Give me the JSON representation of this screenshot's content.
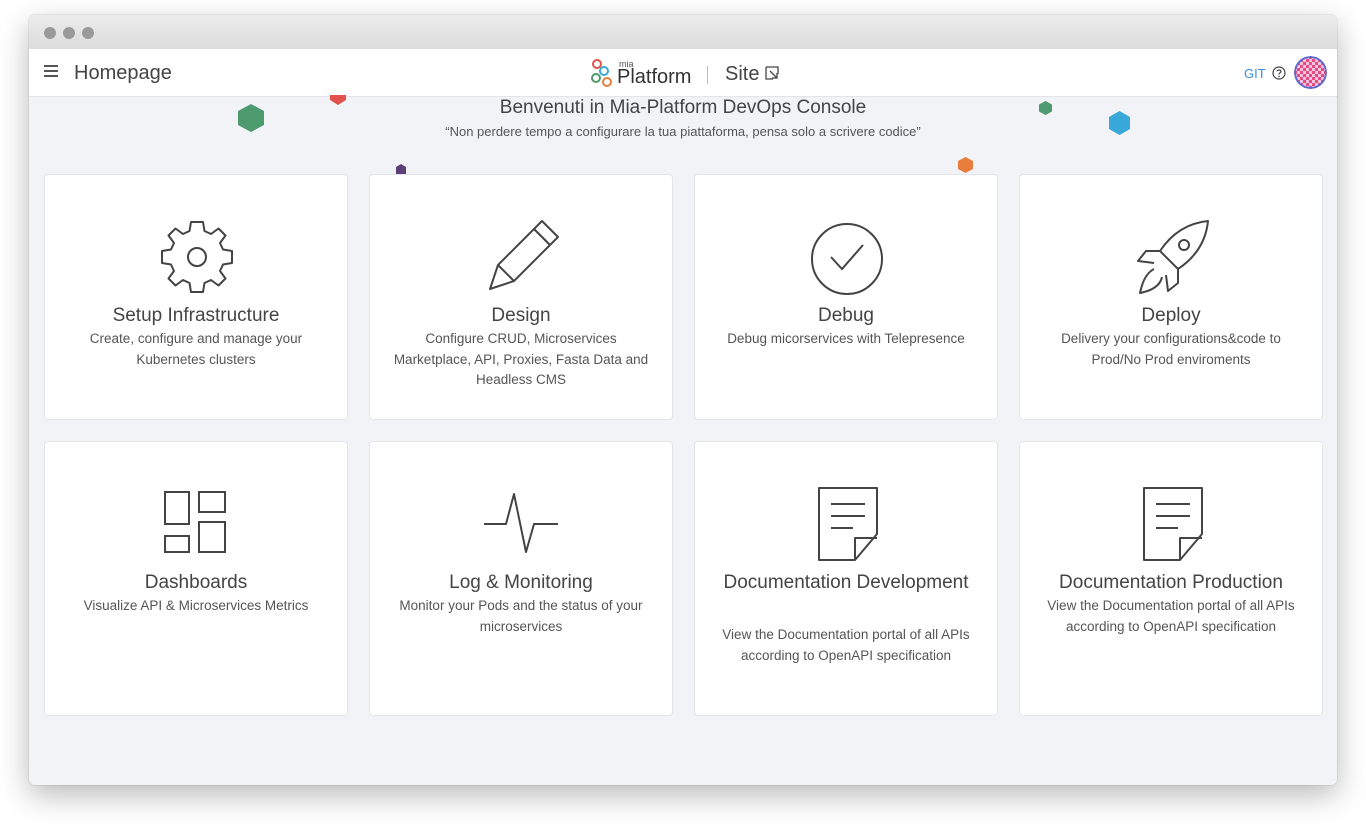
{
  "header": {
    "page_title": "Homepage",
    "brand_small": "mia",
    "brand_name": "Platform",
    "site_label": "Site",
    "git_label": "GIT"
  },
  "welcome": {
    "title": "Benvenuti in Mia-Platform DevOps Console",
    "tagline": "“Non perdere tempo a configurare la tua piattaforma, pensa solo a scrivere codice”"
  },
  "colors": {
    "accent": "#3a8ee6",
    "text": "#444444",
    "background": "#f2f3f6",
    "card": "#ffffff",
    "hex_green": "#4e9a6f",
    "hex_red": "#e0524b",
    "hex_purple": "#5a3f7a",
    "hex_blue": "#3aa7d9",
    "hex_orange": "#e87e3c"
  },
  "cards": [
    {
      "title": "Setup Infrastructure",
      "description": "Create, configure and manage your Kubernetes clusters",
      "icon": "gear-icon"
    },
    {
      "title": "Design",
      "description": "Configure CRUD, Microservices Marketplace, API, Proxies, Fasta Data and Headless CMS",
      "icon": "pencil-icon"
    },
    {
      "title": "Debug",
      "description": "Debug micorservices with Telepresence",
      "icon": "check-circle-icon"
    },
    {
      "title": "Deploy",
      "description": "Delivery your configurations&code to Prod/No Prod enviroments",
      "icon": "rocket-icon"
    },
    {
      "title": "Dashboards",
      "description": "Visualize API & Microservices Metrics",
      "icon": "dashboard-grid-icon"
    },
    {
      "title": "Log & Monitoring",
      "description": "Monitor your Pods and the status of your microservices",
      "icon": "pulse-icon"
    },
    {
      "title": "Documentation Development",
      "description": "View the Documentation portal of all APIs according to OpenAPI specification",
      "icon": "document-icon"
    },
    {
      "title": "Documentation Production",
      "description": "View the Documentation portal of all APIs according to OpenAPI specification",
      "icon": "document-icon"
    }
  ]
}
